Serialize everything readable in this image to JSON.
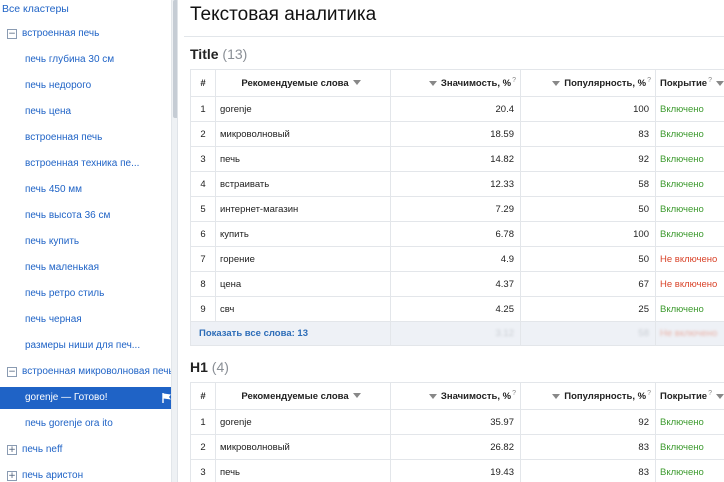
{
  "sidebar": {
    "all_clusters": "Все кластеры",
    "items": [
      {
        "kind": "group",
        "label": "встроенная печь",
        "toggle": "−"
      },
      {
        "kind": "sub",
        "label": "печь глубина 30 см"
      },
      {
        "kind": "sub",
        "label": "печь недорого"
      },
      {
        "kind": "sub",
        "label": "печь цена"
      },
      {
        "kind": "sub",
        "label": "встроенная печь"
      },
      {
        "kind": "sub",
        "label": "встроенная техника пе..."
      },
      {
        "kind": "sub",
        "label": "печь 450 мм"
      },
      {
        "kind": "sub",
        "label": "печь высота 36 см"
      },
      {
        "kind": "sub",
        "label": "печь купить"
      },
      {
        "kind": "sub",
        "label": "печь маленькая"
      },
      {
        "kind": "sub",
        "label": "печь ретро стиль"
      },
      {
        "kind": "sub",
        "label": "печь черная"
      },
      {
        "kind": "sub",
        "label": "размеры ниши для печ..."
      },
      {
        "kind": "group",
        "label": "встроенная микроволновая печь gorenje",
        "toggle": "−"
      },
      {
        "kind": "active",
        "label": "gorenje — Готово!"
      },
      {
        "kind": "sub",
        "label": "печь gorenje ora ito"
      },
      {
        "kind": "group",
        "label": "печь neff",
        "toggle": "+"
      },
      {
        "kind": "group",
        "label": "печь аристон",
        "toggle": "+"
      }
    ]
  },
  "main": {
    "page_title": "Текстовая аналитика",
    "columns": {
      "num": "#",
      "words": "Рекомендуемые слова",
      "importance": "Значимость, %",
      "popularity": "Популярность, %",
      "coverage": "Покрытие",
      "help": "?"
    },
    "title_section": {
      "name": "Title",
      "count": "(13)",
      "rows": [
        {
          "n": "1",
          "word": "gorenje",
          "imp": "20.4",
          "pop": "100",
          "cov": "Включено",
          "status": "yes"
        },
        {
          "n": "2",
          "word": "микроволновый",
          "imp": "18.59",
          "pop": "83",
          "cov": "Включено",
          "status": "yes"
        },
        {
          "n": "3",
          "word": "печь",
          "imp": "14.82",
          "pop": "92",
          "cov": "Включено",
          "status": "yes"
        },
        {
          "n": "4",
          "word": "встраивать",
          "imp": "12.33",
          "pop": "58",
          "cov": "Включено",
          "status": "yes"
        },
        {
          "n": "5",
          "word": "интернет-магазин",
          "imp": "7.29",
          "pop": "50",
          "cov": "Включено",
          "status": "yes"
        },
        {
          "n": "6",
          "word": "купить",
          "imp": "6.78",
          "pop": "100",
          "cov": "Включено",
          "status": "yes"
        },
        {
          "n": "7",
          "word": "горение",
          "imp": "4.9",
          "pop": "50",
          "cov": "Не включено",
          "status": "no"
        },
        {
          "n": "8",
          "word": "цена",
          "imp": "4.37",
          "pop": "67",
          "cov": "Не включено",
          "status": "no"
        },
        {
          "n": "9",
          "word": "свч",
          "imp": "4.25",
          "pop": "25",
          "cov": "Включено",
          "status": "yes"
        }
      ],
      "show_all": "Показать все слова: 13",
      "blurred": {
        "imp": "3.12",
        "pop": "58",
        "cov": "Не включено"
      }
    },
    "h1_section": {
      "name": "H1",
      "count": "(4)",
      "rows": [
        {
          "n": "1",
          "word": "gorenje",
          "imp": "35.97",
          "pop": "92",
          "cov": "Включено",
          "status": "yes"
        },
        {
          "n": "2",
          "word": "микроволновый",
          "imp": "26.82",
          "pop": "83",
          "cov": "Включено",
          "status": "yes"
        },
        {
          "n": "3",
          "word": "печь",
          "imp": "19.43",
          "pop": "83",
          "cov": "Включено",
          "status": "yes"
        }
      ]
    }
  },
  "colors": {
    "accent": "#1f63c6",
    "included": "#3c9a2e",
    "not_included": "#d9442a"
  }
}
